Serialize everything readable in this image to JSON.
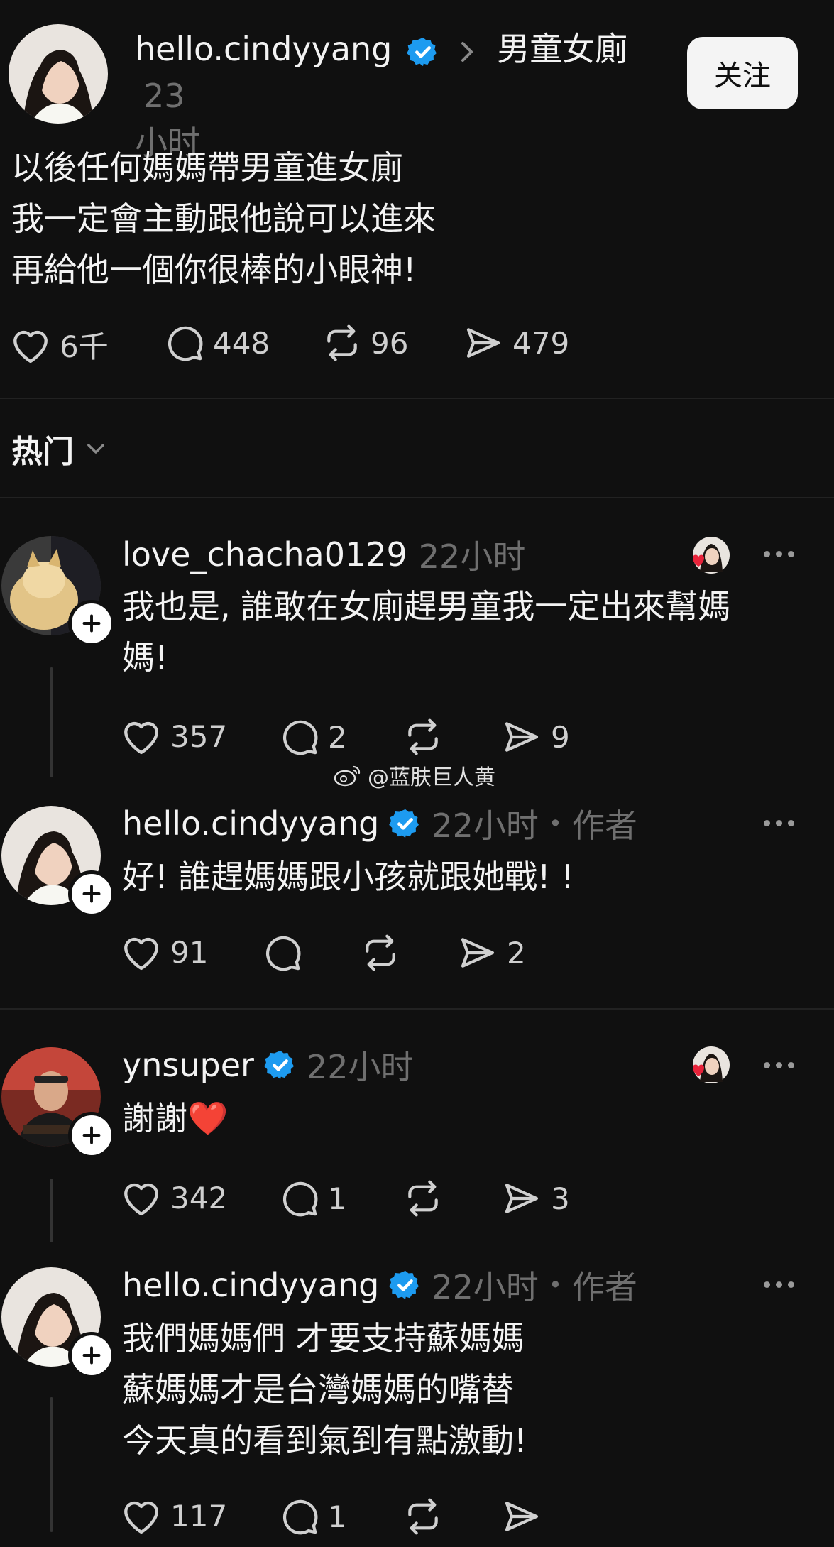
{
  "post": {
    "username": "hello.cindyyang",
    "topic": "男童女廁",
    "time_part1": "23",
    "time_part2": "小时",
    "follow_label": "关注",
    "text": "以後任何媽媽帶男童進女廁\n我一定會主動跟他說可以進來\n再給他一個你很棒的小眼神!",
    "likes": "6千",
    "comments": "448",
    "reposts": "96",
    "shares": "479"
  },
  "sort": {
    "label": "热门"
  },
  "watermark": "@蓝肤巨人黄",
  "replies": [
    {
      "username": "love_chacha0129",
      "time": "22小时",
      "text": "我也是, 誰敢在女廁趕男童我一定出來幫媽\n媽!",
      "likes": "357",
      "comments": "2",
      "reposts": "",
      "shares": "9"
    },
    {
      "username": "hello.cindyyang",
      "time": "22小时",
      "author_tag": "作者",
      "text": "好! 誰趕媽媽跟小孩就跟她戰! !",
      "likes": "91",
      "comments": "",
      "reposts": "",
      "shares": "2"
    },
    {
      "username": "ynsuper",
      "time": "22小时",
      "text": "謝謝❤️",
      "likes": "342",
      "comments": "1",
      "reposts": "",
      "shares": "3"
    },
    {
      "username": "hello.cindyyang",
      "time": "22小时",
      "author_tag": "作者",
      "text": "我們媽媽們 才要支持蘇媽媽\n蘇媽媽才是台灣媽媽的嘴替\n今天真的看到氣到有點激動!",
      "likes": "117",
      "comments": "1",
      "reposts": "",
      "shares": ""
    }
  ],
  "icons": {
    "like": "heart-icon",
    "comment": "comment-bubble-icon",
    "repost": "repost-icon",
    "share": "send-icon",
    "verified": "verified-badge-icon",
    "more": "more-dots-icon"
  },
  "colors": {
    "background": "#101010",
    "verified": "#1d9bf0",
    "liked": "#e8233a"
  }
}
